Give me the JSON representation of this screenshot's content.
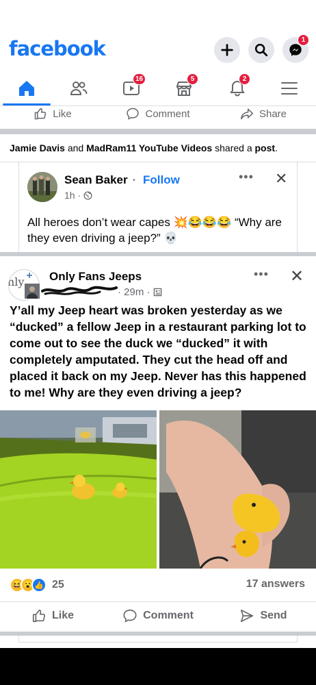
{
  "header": {
    "logo": "facebook",
    "buttons": [
      {
        "name": "create",
        "icon": "plus-icon"
      },
      {
        "name": "search",
        "icon": "search-icon"
      },
      {
        "name": "messenger",
        "icon": "messenger-icon",
        "badge": "1"
      }
    ]
  },
  "nav": {
    "items": [
      {
        "name": "home",
        "icon": "home-icon",
        "active": true
      },
      {
        "name": "friends",
        "icon": "friends-icon"
      },
      {
        "name": "watch",
        "icon": "video-icon",
        "badge": "16"
      },
      {
        "name": "marketplace",
        "icon": "marketplace-icon",
        "badge": "5"
      },
      {
        "name": "notifications",
        "icon": "bell-icon",
        "badge": "2"
      },
      {
        "name": "menu",
        "icon": "hamburger-icon"
      }
    ]
  },
  "top_actions": {
    "like": "Like",
    "comment": "Comment",
    "share": "Share"
  },
  "shared": {
    "user1": "Jamie Davis",
    "and": "and",
    "user2": "MadRam11 YouTube Videos",
    "middle": "shared a",
    "post": "post",
    "end": "."
  },
  "shared_post": {
    "author": "Sean Baker",
    "dot": "·",
    "follow": "Follow",
    "time": "1h ·",
    "text": "All heroes don’t wear capes 💥😂😂😂 “Why are they even driving a jeep?” 💀"
  },
  "post": {
    "page": "Only Fans Jeeps",
    "avatar_text": "nly",
    "time": "· 29m ·",
    "text": "Y’all my Jeep heart was broken yesterday as we “ducked” a fellow Jeep in a restaurant parking lot to come out to see the duck we “ducked” it with completely amputated. They cut the head off and placed it back on my Jeep. Never has this happened to me! Why are they even driving a jeep?",
    "reaction_count": "25",
    "answers": "17 answers"
  },
  "bottom_actions": {
    "like": "Like",
    "comment": "Comment",
    "send": "Send"
  },
  "colors": {
    "brand": "#1877f2",
    "badge": "#e41e3f",
    "secondary_text": "#65676b",
    "jeep_green": "#9bd11b"
  }
}
